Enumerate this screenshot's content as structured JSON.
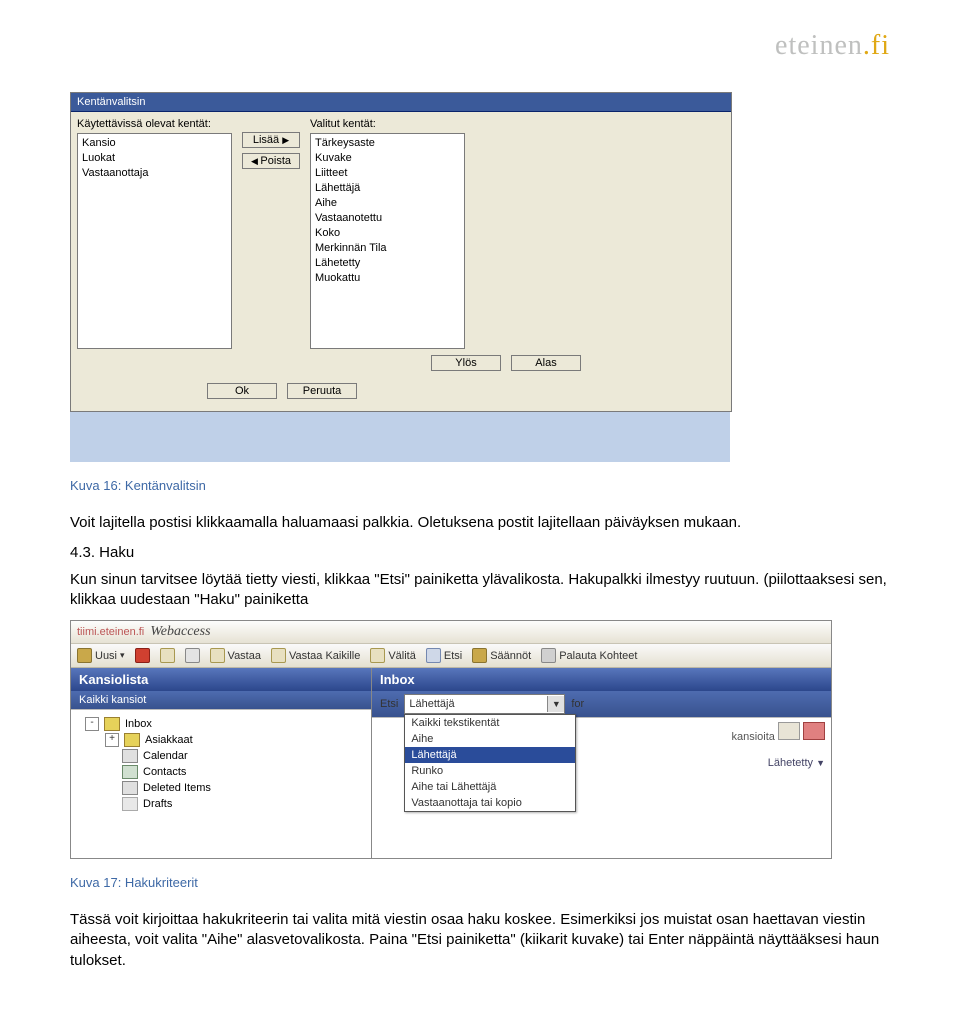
{
  "logo": {
    "grey": "eteinen",
    "gold": ".fi"
  },
  "dialog": {
    "title": "Kentänvalitsin",
    "leftLabel": "Käytettävissä olevat kentät:",
    "rightLabel": "Valitut kentät:",
    "avail": {
      "0": "Kansio",
      "1": "Luokat",
      "2": "Vastaanottaja"
    },
    "selected": {
      "0": "Tärkeysaste",
      "1": "Kuvake",
      "2": "Liitteet",
      "3": "Lähettäjä",
      "4": "Aihe",
      "5": "Vastaanotettu",
      "6": "Koko",
      "7": "Merkinnän Tila",
      "8": "Lähetetty",
      "9": "Muokattu"
    },
    "btn": {
      "add": "Lisää",
      "remove": "Poista",
      "up": "Ylös",
      "down": "Alas",
      "ok": "Ok",
      "cancel": "Peruuta"
    }
  },
  "text": {
    "caption1": "Kuva 16: Kentänvalitsin",
    "p1": "Voit lajitella postisi klikkaamalla haluamaasi palkkia. Oletuksena postit lajitellaan päiväyksen mukaan.",
    "sec": "4.3. Haku",
    "p2": "Kun sinun tarvitsee löytää tietty viesti, klikkaa \"Etsi\" painiketta ylävalikosta. Hakupalkki ilmestyy ruutuun. (piilottaaksesi sen, klikkaa uudestaan \"Haku\" painiketta",
    "caption2": "Kuva 17: Hakukriteerit",
    "p3": "Tässä voit kirjoittaa hakukriteerin tai valita mitä viestin osaa haku koskee. Esimerkiksi jos muistat osan haettavan viestin aiheesta, voit valita \"Aihe\" alasvetovalikosta. Paina \"Etsi painiketta\" (kiikarit kuvake) tai Enter näppäintä näyttääksesi haun tulokset."
  },
  "shot2": {
    "addr": {
      "host": "tiimi.eteinen.fi",
      "app": "Webaccess"
    },
    "toolbar": {
      "uusi": "Uusi",
      "vastaa": "Vastaa",
      "vastaaKaikille": "Vastaa Kaikille",
      "valita": "Välitä",
      "etsi": "Etsi",
      "saannot": "Säännöt",
      "palauta": "Palauta Kohteet"
    },
    "left": {
      "title": "Kansiolista",
      "sub": "Kaikki kansiot",
      "tree": {
        "0": "Inbox",
        "1": "Asiakkaat",
        "2": "Calendar",
        "3": "Contacts",
        "4": "Deleted Items",
        "5": "Drafts"
      }
    },
    "right": {
      "title": "Inbox",
      "etsi": "Etsi",
      "comboValue": "Lähettäjä",
      "for": "for",
      "kansioita": "kansioita",
      "lahetetty": "Lähetetty",
      "dropdown": {
        "0": "Kaikki tekstikentät",
        "1": "Aihe",
        "2": "Lähettäjä",
        "3": "Runko",
        "4": "Aihe tai Lähettäjä",
        "5": "Vastaanottaja tai kopio"
      }
    }
  }
}
